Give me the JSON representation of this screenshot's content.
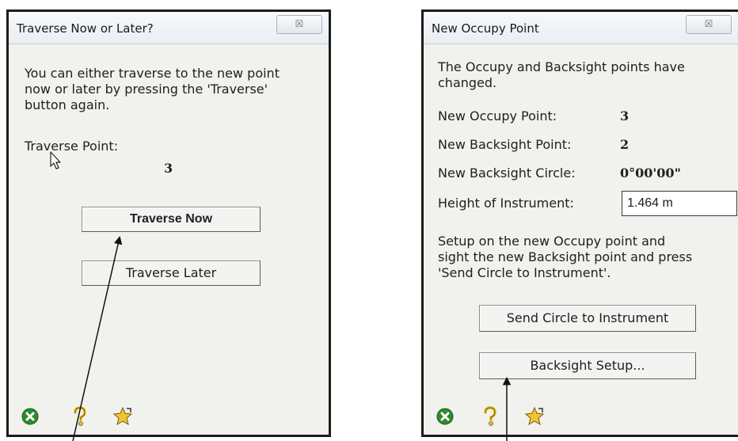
{
  "dialog1": {
    "title": "Traverse Now or Later?",
    "close_glyph": "☒",
    "message_lines": [
      "You can either traverse to the new point",
      "now or later by pressing the 'Traverse'",
      "button again."
    ],
    "point_label": "Traverse Point:",
    "point_value": "3",
    "traverse_now_label": "Traverse Now",
    "traverse_later_label": "Traverse Later",
    "footer_icons": [
      "cancel-icon",
      "help-icon",
      "favorite-icon"
    ]
  },
  "dialog2": {
    "title": "New Occupy Point",
    "close_glyph": "☒",
    "message_lines": [
      "The Occupy and Backsight points have",
      "changed."
    ],
    "fields": [
      {
        "label": "New Occupy Point:",
        "value": "3"
      },
      {
        "label": "New Backsight Point:",
        "value": "2"
      },
      {
        "label": "New Backsight Circle:",
        "value": "0°00'00\""
      }
    ],
    "height_label": "Height of Instrument:",
    "height_value": "1.464 m",
    "instruction_lines": [
      "Setup on the new Occupy point and",
      "sight the new Backsight point and press",
      "'Send Circle to Instrument'."
    ],
    "send_circle_label": "Send Circle to Instrument",
    "backsight_setup_label": "Backsight Setup...",
    "footer_icons": [
      "cancel-icon",
      "help-icon",
      "favorite-icon"
    ]
  },
  "colors": {
    "dialog_bg": "#f1f1ee",
    "cancel_green": "#2e8b2e",
    "help_yellow": "#e8c22a",
    "star_yellow": "#f2c530"
  }
}
